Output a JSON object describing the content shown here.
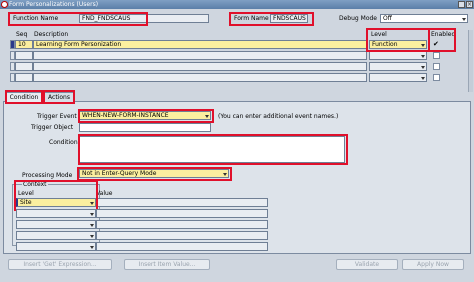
{
  "window": {
    "title": "Form Personalizations (Users)"
  },
  "header": {
    "function_name_label": "Function Name",
    "function_name_value": "FND_FNDSCAUS",
    "form_name_label": "Form Name",
    "form_name_value": "FNDSCAUS",
    "debug_mode_label": "Debug Mode",
    "debug_mode_value": "Off"
  },
  "grid": {
    "seq_header": "Seq",
    "description_header": "Description",
    "level_header": "Level",
    "enabled_header": "Enabled",
    "rows": [
      {
        "seq": "10",
        "description": "Learning Form Personization",
        "level": "Function",
        "enabled": "✔"
      },
      {
        "seq": "",
        "description": "",
        "level": "",
        "enabled": ""
      },
      {
        "seq": "",
        "description": "",
        "level": "",
        "enabled": ""
      },
      {
        "seq": "",
        "description": "",
        "level": "",
        "enabled": ""
      }
    ]
  },
  "tabs": [
    {
      "label": "Condition"
    },
    {
      "label": "Actions"
    }
  ],
  "condition": {
    "trigger_event_label": "Trigger Event",
    "trigger_event_value": "WHEN-NEW-FORM-INSTANCE",
    "trigger_event_hint": "(You can enter additional event names.)",
    "trigger_object_label": "Trigger Object",
    "condition_label": "Condition",
    "processing_mode_label": "Processing Mode",
    "processing_mode_value": "Not in Enter-Query Mode"
  },
  "context": {
    "group_label": "Context",
    "level_header": "Level",
    "value_header": "Value",
    "rows": [
      {
        "level": "Site",
        "value": ""
      },
      {
        "level": "",
        "value": ""
      },
      {
        "level": "",
        "value": ""
      },
      {
        "level": "",
        "value": ""
      },
      {
        "level": "",
        "value": ""
      }
    ]
  },
  "buttons": {
    "insert_get_expression": "Insert 'Get' Expression...",
    "insert_item_value": "Insert Item Value...",
    "validate": "Validate",
    "apply_now": "Apply Now"
  },
  "colors": {
    "highlight_red": "#e0102b",
    "required_yellow": "#fbef9f",
    "title_blue": "#5b7fa8"
  }
}
